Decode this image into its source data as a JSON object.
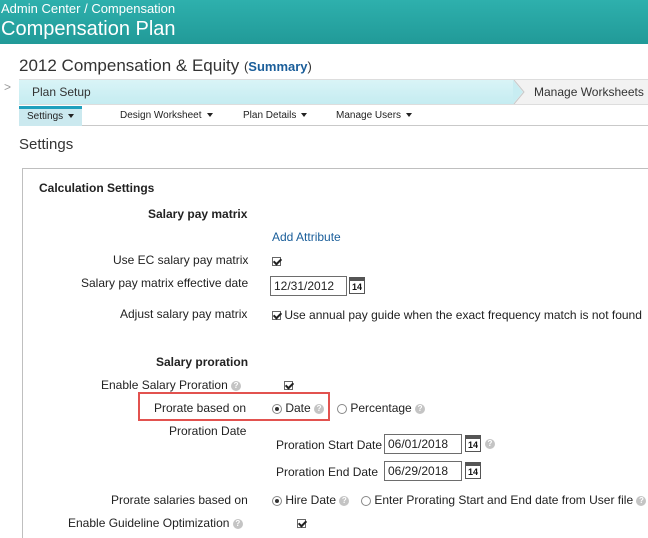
{
  "header": {
    "breadcrumb": "Admin Center / Compensation",
    "title": "Compensation Plan"
  },
  "plan": {
    "name": "2012 Compensation & Equity",
    "summary_open": "(",
    "summary_link": "Summary",
    "summary_close": ")"
  },
  "tabs": {
    "active": "Plan Setup",
    "right": "Manage Worksheets"
  },
  "subnav": [
    {
      "label": "Settings"
    },
    {
      "label": "Design Worksheet"
    },
    {
      "label": "Plan Details"
    },
    {
      "label": "Manage Users"
    }
  ],
  "page_heading": "Settings",
  "calc": {
    "heading": "Calculation Settings",
    "salary_pay_matrix": {
      "heading": "Salary pay matrix",
      "add_attribute": "Add Attribute",
      "use_ec_label": "Use EC salary pay matrix",
      "effective_date_label": "Salary pay matrix effective date",
      "effective_date_value": "12/31/2012",
      "adjust_label": "Adjust salary pay matrix",
      "adjust_option": "Use annual pay guide when the exact frequency match is not found"
    },
    "proration": {
      "heading": "Salary proration",
      "enable_label": "Enable Salary Proration",
      "prorate_based_label": "Prorate based on",
      "option_date": "Date",
      "option_percentage": "Percentage",
      "proration_date_label": "Proration Date",
      "start_label": "Proration Start Date",
      "start_value": "06/01/2018",
      "end_label": "Proration End Date",
      "end_value": "06/29/2018",
      "salaries_based_label": "Prorate salaries based on",
      "option_hire": "Hire Date",
      "option_enter": "Enter Prorating Start and End date from User file"
    },
    "guideline_label": "Enable Guideline Optimization"
  },
  "icons": {
    "calendar": "14",
    "help": "?"
  },
  "colors": {
    "header": "#2aa5a3",
    "link": "#1a5e9a",
    "highlight": "#e2524f",
    "active_tab": "#c5ecf1"
  }
}
